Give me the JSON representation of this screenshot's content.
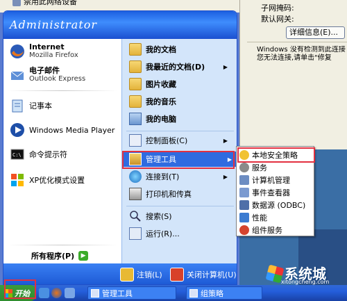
{
  "background": {
    "top_item_label": "禁用此网络设备",
    "panel": {
      "subnet_label": "子网掩码:",
      "gateway_label": "默认网关:",
      "details_button": "详细信息(E)...",
      "message_line1": "Windows 没有检测到此连接",
      "message_line2": "您无法连接,请单击\"修复"
    }
  },
  "start_menu": {
    "user": "Administrator",
    "pinned": [
      {
        "title": "Internet",
        "subtitle": "Mozilla Firefox",
        "icon": "firefox-icon"
      },
      {
        "title": "电子邮件",
        "subtitle": "Outlook Express",
        "icon": "outlook-icon"
      }
    ],
    "recent": [
      {
        "label": "记事本",
        "icon": "notepad-icon"
      },
      {
        "label": "Windows Media Player",
        "icon": "media-player-icon"
      },
      {
        "label": "命令提示符",
        "icon": "cmd-icon"
      },
      {
        "label": "XP优化模式设置",
        "icon": "xp-settings-icon"
      }
    ],
    "all_programs": "所有程序(P)",
    "right": [
      {
        "label": "我的文档",
        "icon": "folder-icon"
      },
      {
        "label": "我最近的文档(D)",
        "icon": "folder-icon",
        "arrow": true
      },
      {
        "label": "图片收藏",
        "icon": "folder-icon"
      },
      {
        "label": "我的音乐",
        "icon": "folder-icon"
      },
      {
        "label": "我的电脑",
        "icon": "computer-icon"
      },
      {
        "label": "控制面板(C)",
        "icon": "control-panel-icon",
        "arrow": true
      },
      {
        "label": "管理工具",
        "icon": "admin-tools-icon",
        "arrow": true
      },
      {
        "label": "连接到(T)",
        "icon": "network-icon",
        "arrow": true
      },
      {
        "label": "打印机和传真",
        "icon": "printer-icon"
      },
      {
        "label": "搜索(S)",
        "icon": "search-icon"
      },
      {
        "label": "运行(R)...",
        "icon": "run-icon"
      }
    ],
    "logoff": "注销(L)",
    "shutdown": "关闭计算机(U)"
  },
  "submenu": [
    {
      "label": "本地安全策略",
      "icon": "security-policy-icon"
    },
    {
      "label": "服务",
      "icon": "services-icon"
    },
    {
      "label": "计算机管理",
      "icon": "computer-management-icon"
    },
    {
      "label": "事件查看器",
      "icon": "event-viewer-icon"
    },
    {
      "label": "数据源 (ODBC)",
      "icon": "odbc-icon"
    },
    {
      "label": "性能",
      "icon": "performance-icon"
    },
    {
      "label": "组件服务",
      "icon": "component-services-icon"
    }
  ],
  "taskbar": {
    "start_label": "开始",
    "tasks": [
      "管理工具",
      "组策略"
    ]
  },
  "watermark": {
    "brand": "系统城",
    "url": "xitongcheng.com"
  }
}
